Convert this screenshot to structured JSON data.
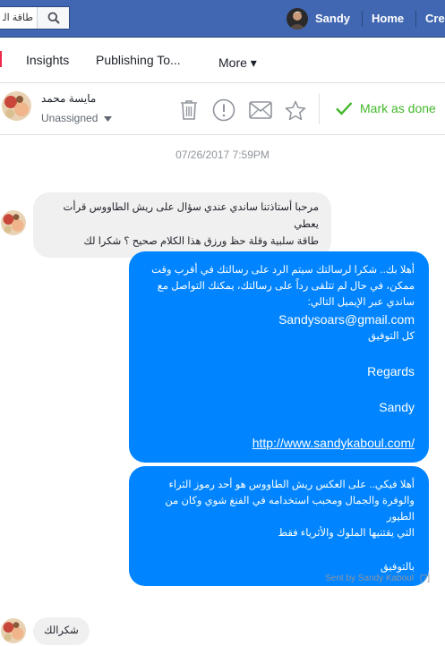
{
  "topbar": {
    "search_text": "طاقة الو",
    "user_name": "Sandy",
    "home_label": "Home",
    "create_label": "Cre"
  },
  "nav": {
    "insights": "Insights",
    "publishing_tools": "Publishing To...",
    "more": "More ▾"
  },
  "conversation": {
    "contact_name": "مايسة محمد",
    "assigned": "Unassigned",
    "mark_done": "Mark as done"
  },
  "thread": {
    "timestamp": "07/26/2017 7:59PM",
    "incoming_1": {
      "line1": "مرحبا أستاذتنا ساندي عندي سؤال على ريش الطاووس قرأت يعطي",
      "line2": "طاقة سلبية وقلة حظ ورزق هذا الكلام صحيح ؟ شكرا لك"
    },
    "outgoing_1": {
      "line1": "أهلا بك.. شكرا لرسالتك سيتم الرد على رسالتك في أقرب وقت",
      "line2": "ممكن، في حال لم تتلقى رداً على رسالتك، يمكنك التواصل مع",
      "line3": "ساندي عبر الإيميل التالي:",
      "email": "Sandysoars@gmail.com",
      "wish": "كل التوفيق",
      "regards": "Regards",
      "signature": "Sandy",
      "link": "http://www.sandykaboul.com/"
    },
    "outgoing_2": {
      "line1": "أهلا فيكي.. على العكس ريش الطاووس هو أحد رموز الثراء",
      "line2": "والوفرة والجمال ومحبب استخدامه في الفنغ شوي وكان من الطيور",
      "line3": "التي يقتنيها الملوك والأثرياء فقط",
      "closing": "بالتوفيق"
    },
    "sent_by": "Sent by Sandy Kaboul",
    "help_mark": "[?]",
    "incoming_2": "شكرالك"
  },
  "colors": {
    "brand_blue": "#4267b2",
    "messenger_blue": "#0084ff",
    "done_green": "#42b72a"
  },
  "icons": [
    "search-icon",
    "trash-icon",
    "alert-icon",
    "envelope-icon",
    "star-icon",
    "checkmark-icon",
    "caret-down-icon"
  ]
}
